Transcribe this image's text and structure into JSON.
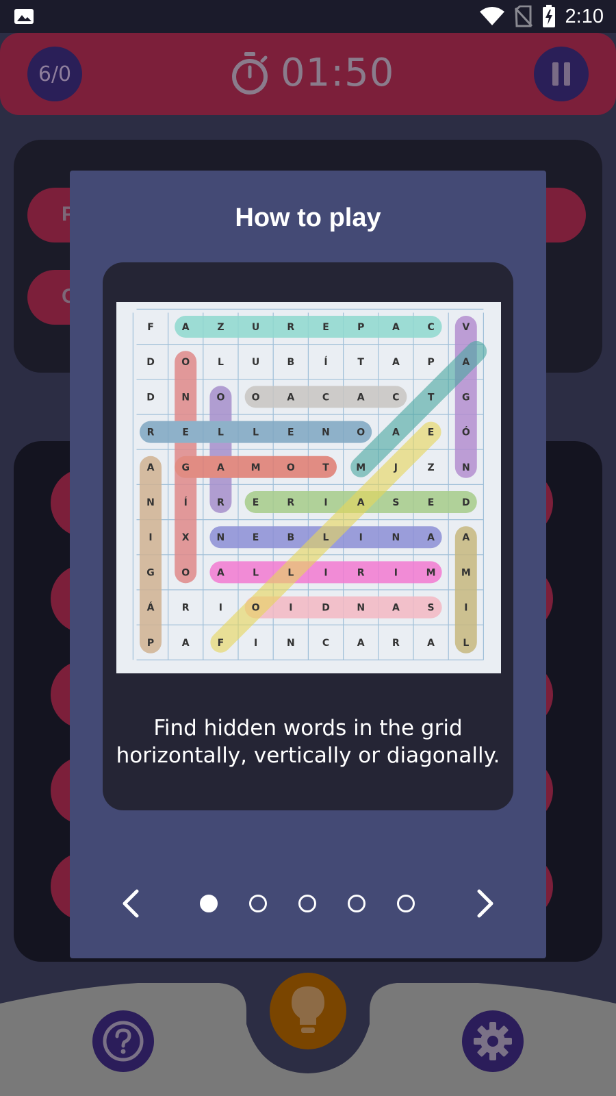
{
  "status_bar": {
    "time": "2:10",
    "icons": [
      "image-notification-icon",
      "wifi-icon",
      "no-sim-icon",
      "battery-charging-icon"
    ]
  },
  "game": {
    "score": "6/0",
    "timer": "01:50",
    "background_pill_labels": [
      "P",
      "C"
    ]
  },
  "modal": {
    "title": "How to play",
    "description_line1": "Find hidden words in the grid",
    "description_line2": "horizontally, vertically or diagonally.",
    "page_count": 5,
    "current_page": 1
  },
  "example_grid": {
    "rows": [
      [
        "F",
        "A",
        "Z",
        "U",
        "R",
        "E",
        "P",
        "A",
        "C",
        "V"
      ],
      [
        "D",
        "O",
        "L",
        "U",
        "B",
        "Í",
        "T",
        "A",
        "P",
        "A"
      ],
      [
        "D",
        "N",
        "O",
        "O",
        "A",
        "C",
        "A",
        "C",
        "T",
        "G"
      ],
      [
        "R",
        "E",
        "L",
        "L",
        "E",
        "N",
        "O",
        "A",
        "E",
        "Ó"
      ],
      [
        "A",
        "G",
        "A",
        "M",
        "O",
        "T",
        "M",
        "J",
        "Z",
        "N"
      ],
      [
        "N",
        "Í",
        "R",
        "E",
        "R",
        "I",
        "A",
        "S",
        "E",
        "D"
      ],
      [
        "I",
        "X",
        "N",
        "E",
        "B",
        "L",
        "I",
        "N",
        "A",
        "A"
      ],
      [
        "G",
        "O",
        "A",
        "L",
        "L",
        "I",
        "R",
        "I",
        "M",
        "M"
      ],
      [
        "Á",
        "R",
        "I",
        "O",
        "I",
        "D",
        "N",
        "A",
        "S",
        "I"
      ],
      [
        "P",
        "A",
        "F",
        "I",
        "N",
        "C",
        "A",
        "R",
        "A",
        "L"
      ]
    ]
  },
  "colors": {
    "modal_bg": "#444a75",
    "card_bg": "#252535",
    "topbar": "#7c1f3a",
    "hint": "#7a4500",
    "nav_button": "#2b1d5a"
  }
}
